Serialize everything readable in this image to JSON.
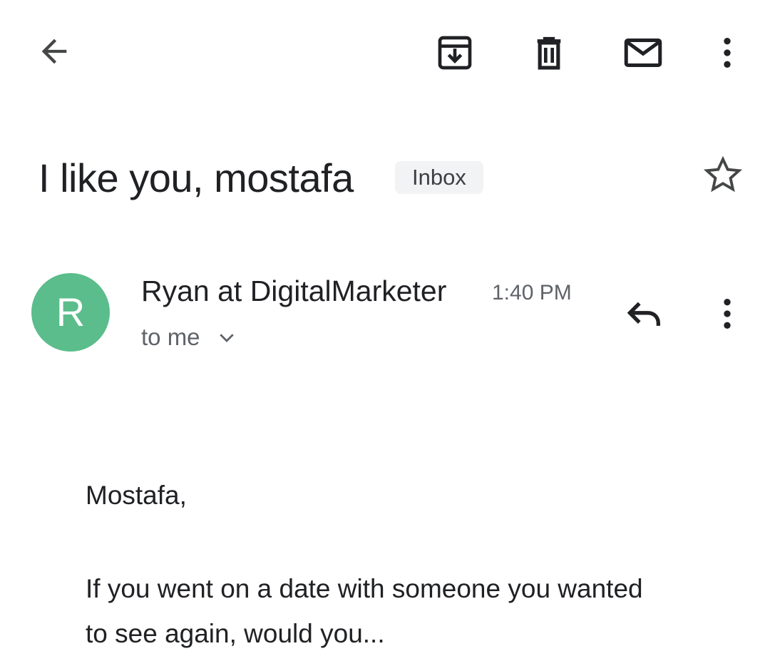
{
  "toolbar": {
    "back_icon": "arrow-back-icon",
    "archive_icon": "archive-icon",
    "delete_icon": "delete-icon",
    "mark_unread_icon": "mail-icon",
    "more_icon": "more-vertical-icon"
  },
  "email": {
    "subject": "I like you, mostafa",
    "label": "Inbox",
    "star_icon": "star-outline-icon"
  },
  "message": {
    "avatar_letter": "R",
    "avatar_color": "#5bbd8b",
    "sender": "Ryan at DigitalMarketer",
    "time": "1:40 PM",
    "recipients": "to me",
    "reply_icon": "reply-icon",
    "more_icon": "more-vertical-icon",
    "greeting": "Mostafa,",
    "paragraph": "If you went on a date with someone you wanted to see again, would you..."
  },
  "colors": {
    "text_primary": "#202124",
    "text_secondary": "#5f6368",
    "chip_bg": "#f1f3f4",
    "icon": "#202124"
  }
}
